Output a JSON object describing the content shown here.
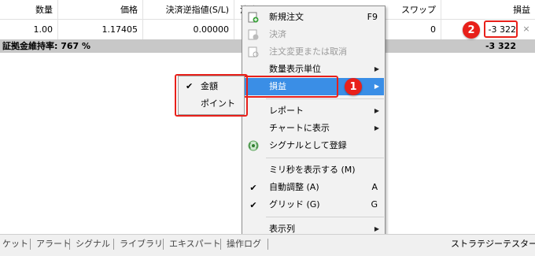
{
  "table": {
    "headers": [
      "数量",
      "価格",
      "決済逆指値(S/L)",
      "決済",
      "スワップ",
      "損益"
    ],
    "row": {
      "volume": "1.00",
      "price": "1.17405",
      "sl": "0.00000",
      "swap": "0",
      "profit": "-3 322"
    },
    "total_label": "証拠金維持率: 767 %",
    "total_value": "-3 322",
    "close_glyph": "×"
  },
  "badges": {
    "one": "1",
    "two": "2"
  },
  "context_menu": {
    "items": [
      {
        "label": "新規注文",
        "shortcut": "F9",
        "icon": "new-order-icon"
      },
      {
        "label": "決済",
        "icon": "close-order-icon",
        "disabled": true
      },
      {
        "label": "注文変更または取消",
        "icon": "modify-order-icon",
        "disabled": true
      },
      {
        "label": "数量表示単位",
        "submenu": true
      },
      {
        "label": "損益",
        "submenu": true,
        "active": true
      },
      {
        "label": "レポート",
        "submenu": true
      },
      {
        "label": "チャートに表示",
        "submenu": true
      },
      {
        "label": "シグナルとして登録",
        "icon": "signal-icon"
      },
      {
        "label": "ミリ秒を表示する (M)"
      },
      {
        "label": "自動調整 (A)",
        "shortcut": "A",
        "checked": true
      },
      {
        "label": "グリッド (G)",
        "shortcut": "G",
        "checked": true
      },
      {
        "label": "表示列",
        "submenu": true
      }
    ],
    "arrow_glyph": "▶",
    "check_glyph": "✔"
  },
  "profit_submenu": {
    "items": [
      {
        "label": "金額",
        "checked": true
      },
      {
        "label": "ポイント",
        "checked": false
      }
    ]
  },
  "tabs": [
    "ケット",
    "アラート",
    "シグナル",
    "ライブラリ",
    "エキスパート",
    "操作ログ"
  ],
  "tester_tab": "ストラテジーテスター",
  "colors": {
    "accent_red": "#e8201a",
    "menu_highlight": "#3a8ee6",
    "total_bar": "#c8c8c8"
  }
}
